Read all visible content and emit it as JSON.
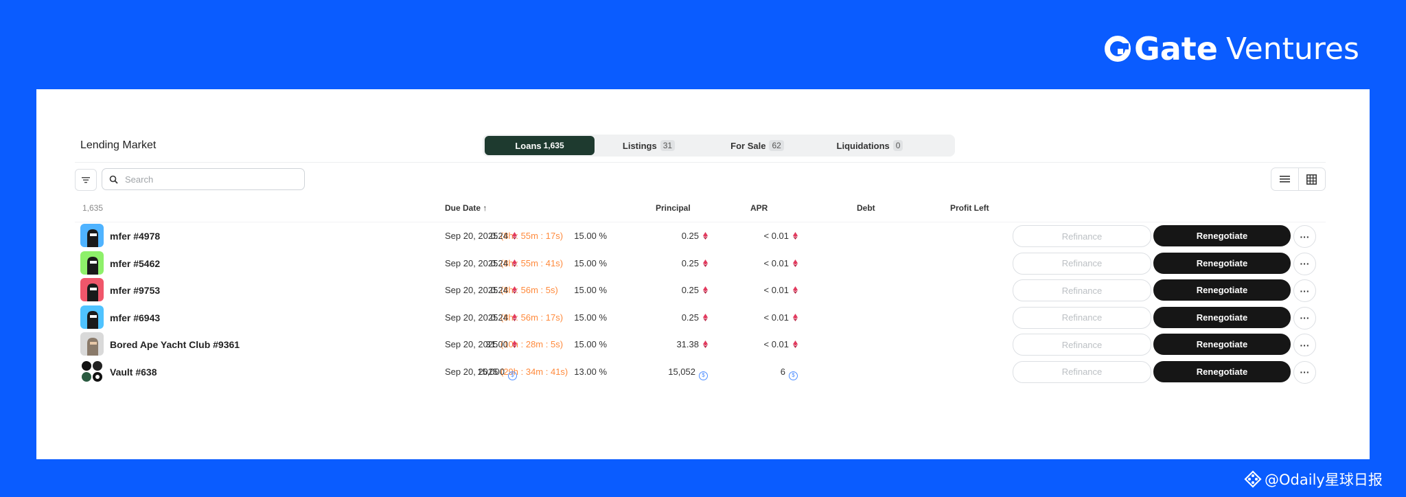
{
  "brand": {
    "name_bold": "Gate",
    "name_light": "Ventures",
    "color": "#0a5cff"
  },
  "market": {
    "title": "Lending Market",
    "tabs": [
      {
        "label": "Loans",
        "count": "1,635",
        "active": true
      },
      {
        "label": "Listings",
        "count": "31",
        "active": false
      },
      {
        "label": "For Sale",
        "count": "62",
        "active": false
      },
      {
        "label": "Liquidations",
        "count": "0",
        "active": false
      }
    ],
    "search_placeholder": "Search",
    "total": "1,635",
    "columns": {
      "due_date": "Due Date",
      "principal": "Principal",
      "apr": "APR",
      "debt": "Debt",
      "profit_left": "Profit Left"
    }
  },
  "loans": [
    {
      "name": "mfer #4978",
      "due_date": "Sep 20, 2025",
      "remaining": "(8h : 55m : 17s)",
      "principal": "0.24",
      "apr": "15.00 %",
      "debt": "0.25",
      "profit": "< 0.01",
      "currency": "eth",
      "avatar_color": "#4fb3ff"
    },
    {
      "name": "mfer #5462",
      "due_date": "Sep 20, 2025",
      "remaining": "(8h : 55m : 41s)",
      "principal": "0.24",
      "apr": "15.00 %",
      "debt": "0.25",
      "profit": "< 0.01",
      "currency": "eth",
      "avatar_color": "#8ef06a"
    },
    {
      "name": "mfer #9753",
      "due_date": "Sep 20, 2025",
      "remaining": "(8h : 56m : 5s)",
      "principal": "0.24",
      "apr": "15.00 %",
      "debt": "0.25",
      "profit": "< 0.01",
      "currency": "eth",
      "avatar_color": "#f0566a"
    },
    {
      "name": "mfer #6943",
      "due_date": "Sep 20, 2025",
      "remaining": "(8h : 56m : 17s)",
      "principal": "0.24",
      "apr": "15.00 %",
      "debt": "0.25",
      "profit": "< 0.01",
      "currency": "eth",
      "avatar_color": "#4fc3ff"
    },
    {
      "name": "Bored Ape Yacht Club #9361",
      "due_date": "Sep 20, 2025",
      "remaining": "(10h : 28m : 5s)",
      "principal": "31.00",
      "apr": "15.00 %",
      "debt": "31.38",
      "profit": "< 0.01",
      "currency": "eth",
      "avatar_color": "#d9d9d9"
    },
    {
      "name": "Vault #638",
      "due_date": "Sep 20, 2025",
      "remaining": "(29h : 34m : 41s)",
      "principal": "15,000",
      "apr": "13.00 %",
      "debt": "15,052",
      "profit": "6",
      "currency": "usdc",
      "avatar_color": "#ffffff"
    }
  ],
  "actions": {
    "refinance": "Refinance",
    "renegotiate": "Renegotiate",
    "more": "···"
  },
  "watermark": {
    "handle": "@Odaily星球日报"
  }
}
